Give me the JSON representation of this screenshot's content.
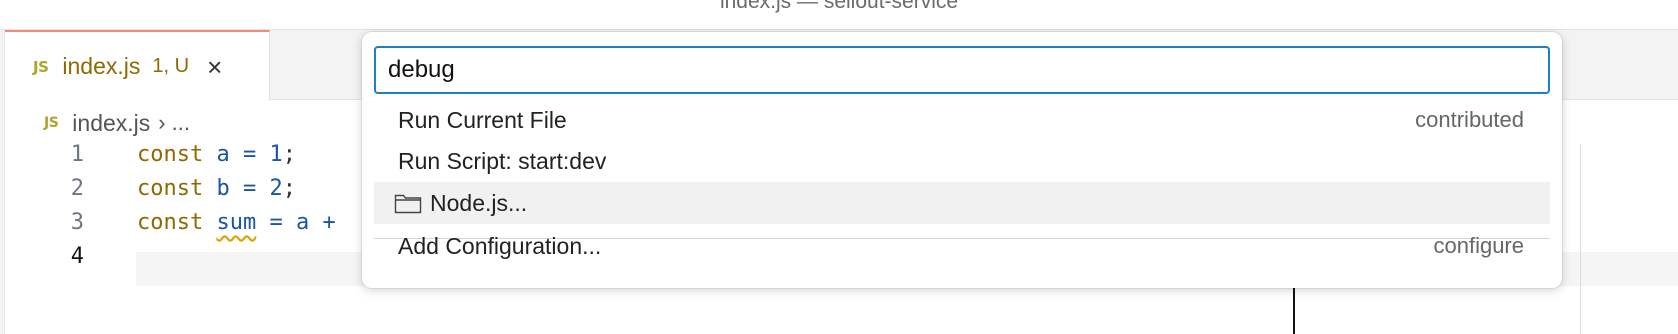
{
  "window": {
    "title": "index.js — sellout-service"
  },
  "tab": {
    "badge": "JS",
    "name": "index.js",
    "status": "1, U",
    "close": "×"
  },
  "breadcrumb": {
    "badge": "JS",
    "file": "index.js",
    "sep": "›",
    "more": "..."
  },
  "editor": {
    "lines": [
      {
        "num": "1",
        "kw": "const",
        "var": "a",
        "op": "=",
        "val": "1",
        "end": ";"
      },
      {
        "num": "2",
        "kw": "const",
        "var": "b",
        "op": "=",
        "val": "2",
        "end": ";"
      },
      {
        "num": "3",
        "kw": "const",
        "var": "sum",
        "op": "=",
        "val": "a +",
        "end": ""
      },
      {
        "num": "4"
      }
    ]
  },
  "quickpick": {
    "input_value": "debug",
    "items": [
      {
        "label": "Run Current File",
        "description": "contributed"
      },
      {
        "label": "Run Script: start:dev",
        "description": ""
      },
      {
        "label": "Node.js...",
        "description": "",
        "icon": "folder-icon"
      },
      {
        "label": "Add Configuration...",
        "description": "configure"
      }
    ]
  },
  "colors": {
    "accent": "#1e7fc8",
    "tab_border": "#f08a7a",
    "keyword": "#8e6a00",
    "identifier": "#1a55a8"
  }
}
